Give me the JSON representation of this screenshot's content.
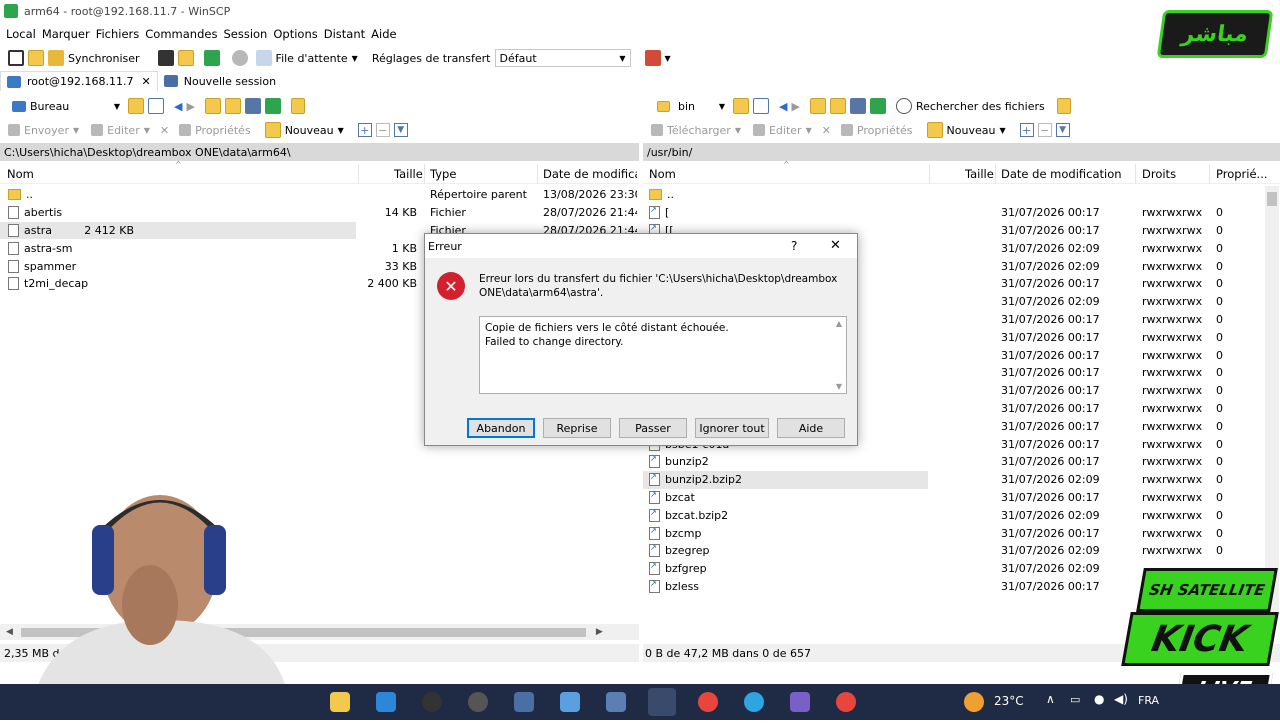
{
  "window": {
    "title": "arm64 - root@192.168.11.7 - WinSCP"
  },
  "menu": [
    "Local",
    "Marquer",
    "Fichiers",
    "Commandes",
    "Session",
    "Options",
    "Distant",
    "Aide"
  ],
  "toolbar": {
    "synchronize": "Synchroniser",
    "queue": "File d'attente",
    "transfer_settings_label": "Réglages de transfert",
    "transfer_settings_value": "Défaut"
  },
  "tabs": {
    "session": "root@192.168.11.7",
    "new_session": "Nouvelle session"
  },
  "left": {
    "location": "Bureau",
    "actions": {
      "send": "Envoyer",
      "edit": "Editer",
      "properties": "Propriétés",
      "new": "Nouveau"
    },
    "path": "C:\\Users\\hicha\\Desktop\\dreambox ONE\\data\\arm64\\",
    "columns": {
      "name": "Nom",
      "size": "Taille",
      "type": "Type",
      "date": "Date de modificatio"
    },
    "files": [
      {
        "name": "..",
        "size": "",
        "type": "Répertoire parent",
        "date": "13/08/2026  23:30:1",
        "kind": "parent"
      },
      {
        "name": "abertis",
        "size": "14 KB",
        "type": "Fichier",
        "date": "28/07/2026  21:44:5",
        "kind": "file"
      },
      {
        "name": "astra",
        "size": "2 412 KB",
        "type": "Fichier",
        "date": "28/07/2026  21:44:5",
        "kind": "file"
      },
      {
        "name": "astra-sm",
        "size": "1 KB",
        "type": "",
        "date": "",
        "kind": "file"
      },
      {
        "name": "spammer",
        "size": "33 KB",
        "type": "",
        "date": "",
        "kind": "file"
      },
      {
        "name": "t2mi_decap",
        "size": "2 400 KB",
        "type": "",
        "date": "",
        "kind": "file"
      }
    ],
    "status": "2,35 MB de"
  },
  "right": {
    "location": "bin",
    "find_files": "Rechercher des fichiers",
    "actions": {
      "download": "Télécharger",
      "edit": "Editer",
      "properties": "Propriétés",
      "new": "Nouveau"
    },
    "path": "/usr/bin/",
    "columns": {
      "name": "Nom",
      "size": "Taille",
      "date": "Date de modification",
      "rights": "Droits",
      "owner": "Proprié..."
    },
    "files": [
      {
        "name": "..",
        "date": "",
        "rights": "",
        "owner": "",
        "kind": "parent"
      },
      {
        "name": "[",
        "date": "31/07/2026 00:17",
        "rights": "rwxrwxrwx",
        "owner": "0",
        "kind": "link"
      },
      {
        "name": "[[",
        "date": "31/07/2026 00:17",
        "rights": "rwxrwxrwx",
        "owner": "0",
        "kind": "link"
      },
      {
        "name": "",
        "date": "31/07/2026 02:09",
        "rights": "rwxrwxrwx",
        "owner": "0",
        "kind": "link"
      },
      {
        "name": "",
        "date": "31/07/2026 02:09",
        "rights": "rwxrwxrwx",
        "owner": "0",
        "kind": "link"
      },
      {
        "name": "",
        "date": "31/07/2026 00:17",
        "rights": "rwxrwxrwx",
        "owner": "0",
        "kind": "link"
      },
      {
        "name": "",
        "date": "31/07/2026 02:09",
        "rights": "rwxrwxrwx",
        "owner": "0",
        "kind": "link"
      },
      {
        "name": "",
        "date": "31/07/2026 00:17",
        "rights": "rwxrwxrwx",
        "owner": "0",
        "kind": "link"
      },
      {
        "name": "",
        "date": "31/07/2026 00:17",
        "rights": "rwxrwxrwx",
        "owner": "0",
        "kind": "link"
      },
      {
        "name": "",
        "date": "31/07/2026 00:17",
        "rights": "rwxrwxrwx",
        "owner": "0",
        "kind": "link"
      },
      {
        "name": "",
        "date": "31/07/2026 00:17",
        "rights": "rwxrwxrwx",
        "owner": "0",
        "kind": "link"
      },
      {
        "name": "",
        "date": "31/07/2026 00:17",
        "rights": "rwxrwxrwx",
        "owner": "0",
        "kind": "link"
      },
      {
        "name": "",
        "date": "31/07/2026 00:17",
        "rights": "rwxrwxrwx",
        "owner": "0",
        "kind": "link"
      },
      {
        "name": "",
        "date": "31/07/2026 00:17",
        "rights": "rwxrwxrwx",
        "owner": "0",
        "kind": "link"
      },
      {
        "name": "bsbe1-c01a",
        "date": "31/07/2026 00:17",
        "rights": "rwxrwxrwx",
        "owner": "0",
        "kind": "link"
      },
      {
        "name": "bunzip2",
        "date": "31/07/2026 00:17",
        "rights": "rwxrwxrwx",
        "owner": "0",
        "kind": "link"
      },
      {
        "name": "bunzip2.bzip2",
        "date": "31/07/2026 02:09",
        "rights": "rwxrwxrwx",
        "owner": "0",
        "kind": "link"
      },
      {
        "name": "bzcat",
        "date": "31/07/2026 00:17",
        "rights": "rwxrwxrwx",
        "owner": "0",
        "kind": "link"
      },
      {
        "name": "bzcat.bzip2",
        "date": "31/07/2026 02:09",
        "rights": "rwxrwxrwx",
        "owner": "0",
        "kind": "link"
      },
      {
        "name": "bzcmp",
        "date": "31/07/2026 00:17",
        "rights": "rwxrwxrwx",
        "owner": "0",
        "kind": "link"
      },
      {
        "name": "bzegrep",
        "date": "31/07/2026 02:09",
        "rights": "rwxrwxrwx",
        "owner": "0",
        "kind": "link"
      },
      {
        "name": "bzfgrep",
        "date": "31/07/2026 02:09",
        "rights": "",
        "owner": "",
        "kind": "link"
      },
      {
        "name": "bzless",
        "date": "31/07/2026 00:17",
        "rights": "",
        "owner": "",
        "kind": "link"
      }
    ],
    "status": "0 B de 47,2 MB dans 0 de 657"
  },
  "dialog": {
    "title": "Erreur",
    "message": "Erreur lors du transfert du fichier 'C:\\Users\\hicha\\Desktop\\dreambox ONE\\data\\arm64\\astra'.",
    "details_line1": "Copie de fichiers vers le côté distant échouée.",
    "details_line2": "Failed to change directory.",
    "buttons": {
      "abort": "Abandon",
      "retry": "Reprise",
      "skip": "Passer",
      "skip_all": "Ignorer tout",
      "help": "Aide"
    },
    "help_glyph": "?",
    "close_glyph": "✕"
  },
  "overlay": {
    "live_label": "مباشر",
    "brand_top": "SH SATELLITE",
    "brand_main": "KICK",
    "brand_live": "LIVE"
  },
  "taskbar": {
    "weather": "23°C",
    "lang": "FRA"
  }
}
